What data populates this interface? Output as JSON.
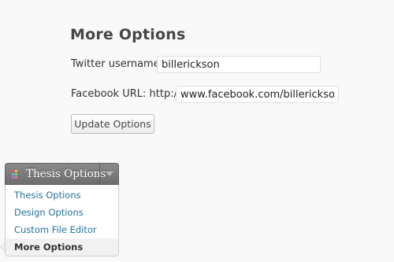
{
  "page": {
    "title": "More Options"
  },
  "form": {
    "twitter_label": "Twitter username:",
    "twitter_value": "billerickson",
    "facebook_label": "Facebook URL: http://",
    "facebook_value": "www.facebook.com/billerickson",
    "submit_label": "Update Options"
  },
  "menu": {
    "header_title": "Thesis Options",
    "logo_icon": "thesis-logo-icon",
    "toggle_icon": "triangle-down-icon",
    "items": [
      {
        "label": "Thesis Options"
      },
      {
        "label": "Design Options"
      },
      {
        "label": "Custom File Editor"
      },
      {
        "label": "More Options"
      }
    ]
  },
  "colors": {
    "link": "#21759b",
    "menu_header": "#7a7a7a",
    "background": "#f9f9f9"
  }
}
